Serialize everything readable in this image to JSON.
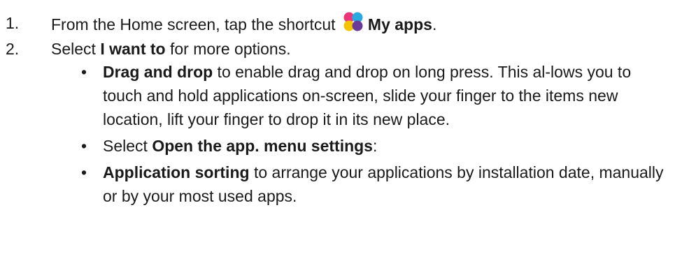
{
  "steps": [
    {
      "number": "1.",
      "text_before": "From the Home screen, tap the shortcut",
      "icon": "my-apps-icon",
      "bold_text": "My apps",
      "text_after": "."
    },
    {
      "number": "2.",
      "text_before": "Select",
      "bold_text": "I want to",
      "text_after": " for more options."
    }
  ],
  "bullets": [
    {
      "bold_text": "Drag and drop",
      "text_after": " to enable drag and drop on long press. This al-lows you to touch and hold applications on-screen, slide your finger to the items new location, lift your finger to drop it in its new place."
    },
    {
      "text_before": "Select ",
      "bold_text": "Open the app. menu settings",
      "text_after": ":"
    },
    {
      "bold_text": "Application sorting",
      "text_after": " to arrange your applications by installation date, manually or by your most used apps."
    }
  ],
  "colors": {
    "text": "#1a1a1a",
    "icon_pink": "#e8387a",
    "icon_blue": "#2aa9e0",
    "icon_yellow": "#f5c400",
    "icon_purple": "#6a3a98"
  }
}
